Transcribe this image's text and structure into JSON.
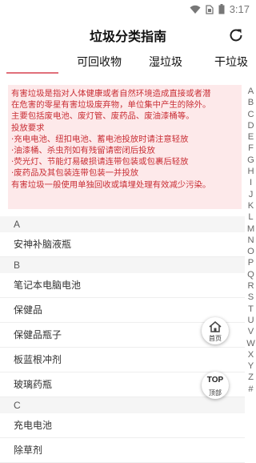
{
  "status_bar": {
    "time": "3:17",
    "icons": [
      "wifi-icon",
      "sim-icon",
      "battery-icon"
    ]
  },
  "header": {
    "title": "垃圾分类指南",
    "refresh_icon": "refresh-icon"
  },
  "tabs": [
    {
      "label": "有害垃圾",
      "active": true
    },
    {
      "label": "可回收物",
      "active": false
    },
    {
      "label": "湿垃圾",
      "active": false
    },
    {
      "label": "干垃圾",
      "active": false
    }
  ],
  "info": {
    "lines": [
      "有害垃圾是指对人体健康或者自然环境造成直接或者潜",
      "在危害的零星有害垃圾废弃物，单位集中产生的除外。",
      "主要包括废电池、废灯管、废药品、废油漆桶等。",
      "投放要求",
      "·充电电池、纽扣电池、蓄电池投放时请注意轻放",
      "·油漆桶、杀虫剂如有残留请密闭后投放",
      "·荧光灯、节能灯易破损请连带包装或包裹后轻放",
      "·废药品及其包装连带包装一并投放",
      "有害垃圾一般使用单独回收或填埋处理有效减少污染。"
    ]
  },
  "index_letters": [
    "A",
    "B",
    "C",
    "D",
    "E",
    "F",
    "G",
    "H",
    "I",
    "J",
    "K",
    "L",
    "M",
    "N",
    "O",
    "P",
    "Q",
    "R",
    "S",
    "T",
    "U",
    "V",
    "W",
    "X",
    "Y",
    "Z",
    "#"
  ],
  "list": {
    "sections": [
      {
        "letter": "A",
        "items": [
          "安神补脑液瓶"
        ]
      },
      {
        "letter": "B",
        "items": [
          "笔记本电脑电池",
          "保健品",
          "保健品瓶子",
          "板蓝根冲剂",
          "玻璃药瓶"
        ]
      },
      {
        "letter": "C",
        "items": [
          "充电电池",
          "除草剂"
        ]
      }
    ]
  },
  "fab_home": {
    "label": "首页",
    "icon": "home-icon"
  },
  "fab_top": {
    "label": "顶部",
    "icon_text": "TOP"
  },
  "colors": {
    "tab_active_bg": "#0a2b55",
    "tab_underline": "#e0707a",
    "info_bg": "#fde9ea",
    "info_text": "#c92f36"
  }
}
